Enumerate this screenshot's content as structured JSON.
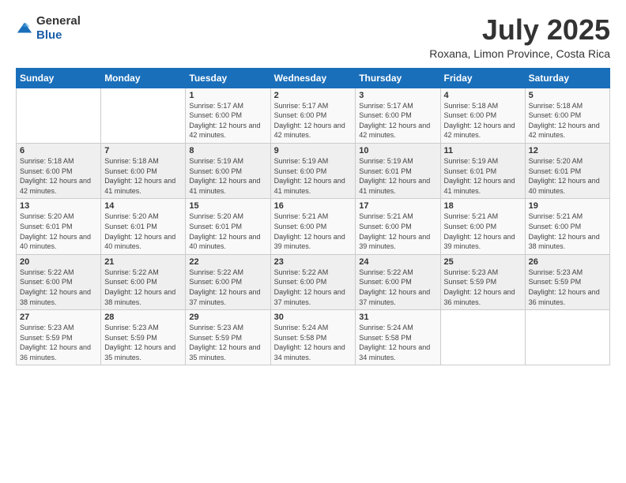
{
  "logo": {
    "general": "General",
    "blue": "Blue"
  },
  "header": {
    "title": "July 2025",
    "subtitle": "Roxana, Limon Province, Costa Rica"
  },
  "weekdays": [
    "Sunday",
    "Monday",
    "Tuesday",
    "Wednesday",
    "Thursday",
    "Friday",
    "Saturday"
  ],
  "weeks": [
    [
      {
        "day": "",
        "info": ""
      },
      {
        "day": "",
        "info": ""
      },
      {
        "day": "1",
        "info": "Sunrise: 5:17 AM\nSunset: 6:00 PM\nDaylight: 12 hours and 42 minutes."
      },
      {
        "day": "2",
        "info": "Sunrise: 5:17 AM\nSunset: 6:00 PM\nDaylight: 12 hours and 42 minutes."
      },
      {
        "day": "3",
        "info": "Sunrise: 5:17 AM\nSunset: 6:00 PM\nDaylight: 12 hours and 42 minutes."
      },
      {
        "day": "4",
        "info": "Sunrise: 5:18 AM\nSunset: 6:00 PM\nDaylight: 12 hours and 42 minutes."
      },
      {
        "day": "5",
        "info": "Sunrise: 5:18 AM\nSunset: 6:00 PM\nDaylight: 12 hours and 42 minutes."
      }
    ],
    [
      {
        "day": "6",
        "info": "Sunrise: 5:18 AM\nSunset: 6:00 PM\nDaylight: 12 hours and 42 minutes."
      },
      {
        "day": "7",
        "info": "Sunrise: 5:18 AM\nSunset: 6:00 PM\nDaylight: 12 hours and 41 minutes."
      },
      {
        "day": "8",
        "info": "Sunrise: 5:19 AM\nSunset: 6:00 PM\nDaylight: 12 hours and 41 minutes."
      },
      {
        "day": "9",
        "info": "Sunrise: 5:19 AM\nSunset: 6:00 PM\nDaylight: 12 hours and 41 minutes."
      },
      {
        "day": "10",
        "info": "Sunrise: 5:19 AM\nSunset: 6:01 PM\nDaylight: 12 hours and 41 minutes."
      },
      {
        "day": "11",
        "info": "Sunrise: 5:19 AM\nSunset: 6:01 PM\nDaylight: 12 hours and 41 minutes."
      },
      {
        "day": "12",
        "info": "Sunrise: 5:20 AM\nSunset: 6:01 PM\nDaylight: 12 hours and 40 minutes."
      }
    ],
    [
      {
        "day": "13",
        "info": "Sunrise: 5:20 AM\nSunset: 6:01 PM\nDaylight: 12 hours and 40 minutes."
      },
      {
        "day": "14",
        "info": "Sunrise: 5:20 AM\nSunset: 6:01 PM\nDaylight: 12 hours and 40 minutes."
      },
      {
        "day": "15",
        "info": "Sunrise: 5:20 AM\nSunset: 6:01 PM\nDaylight: 12 hours and 40 minutes."
      },
      {
        "day": "16",
        "info": "Sunrise: 5:21 AM\nSunset: 6:00 PM\nDaylight: 12 hours and 39 minutes."
      },
      {
        "day": "17",
        "info": "Sunrise: 5:21 AM\nSunset: 6:00 PM\nDaylight: 12 hours and 39 minutes."
      },
      {
        "day": "18",
        "info": "Sunrise: 5:21 AM\nSunset: 6:00 PM\nDaylight: 12 hours and 39 minutes."
      },
      {
        "day": "19",
        "info": "Sunrise: 5:21 AM\nSunset: 6:00 PM\nDaylight: 12 hours and 38 minutes."
      }
    ],
    [
      {
        "day": "20",
        "info": "Sunrise: 5:22 AM\nSunset: 6:00 PM\nDaylight: 12 hours and 38 minutes."
      },
      {
        "day": "21",
        "info": "Sunrise: 5:22 AM\nSunset: 6:00 PM\nDaylight: 12 hours and 38 minutes."
      },
      {
        "day": "22",
        "info": "Sunrise: 5:22 AM\nSunset: 6:00 PM\nDaylight: 12 hours and 37 minutes."
      },
      {
        "day": "23",
        "info": "Sunrise: 5:22 AM\nSunset: 6:00 PM\nDaylight: 12 hours and 37 minutes."
      },
      {
        "day": "24",
        "info": "Sunrise: 5:22 AM\nSunset: 6:00 PM\nDaylight: 12 hours and 37 minutes."
      },
      {
        "day": "25",
        "info": "Sunrise: 5:23 AM\nSunset: 5:59 PM\nDaylight: 12 hours and 36 minutes."
      },
      {
        "day": "26",
        "info": "Sunrise: 5:23 AM\nSunset: 5:59 PM\nDaylight: 12 hours and 36 minutes."
      }
    ],
    [
      {
        "day": "27",
        "info": "Sunrise: 5:23 AM\nSunset: 5:59 PM\nDaylight: 12 hours and 36 minutes."
      },
      {
        "day": "28",
        "info": "Sunrise: 5:23 AM\nSunset: 5:59 PM\nDaylight: 12 hours and 35 minutes."
      },
      {
        "day": "29",
        "info": "Sunrise: 5:23 AM\nSunset: 5:59 PM\nDaylight: 12 hours and 35 minutes."
      },
      {
        "day": "30",
        "info": "Sunrise: 5:24 AM\nSunset: 5:58 PM\nDaylight: 12 hours and 34 minutes."
      },
      {
        "day": "31",
        "info": "Sunrise: 5:24 AM\nSunset: 5:58 PM\nDaylight: 12 hours and 34 minutes."
      },
      {
        "day": "",
        "info": ""
      },
      {
        "day": "",
        "info": ""
      }
    ]
  ]
}
